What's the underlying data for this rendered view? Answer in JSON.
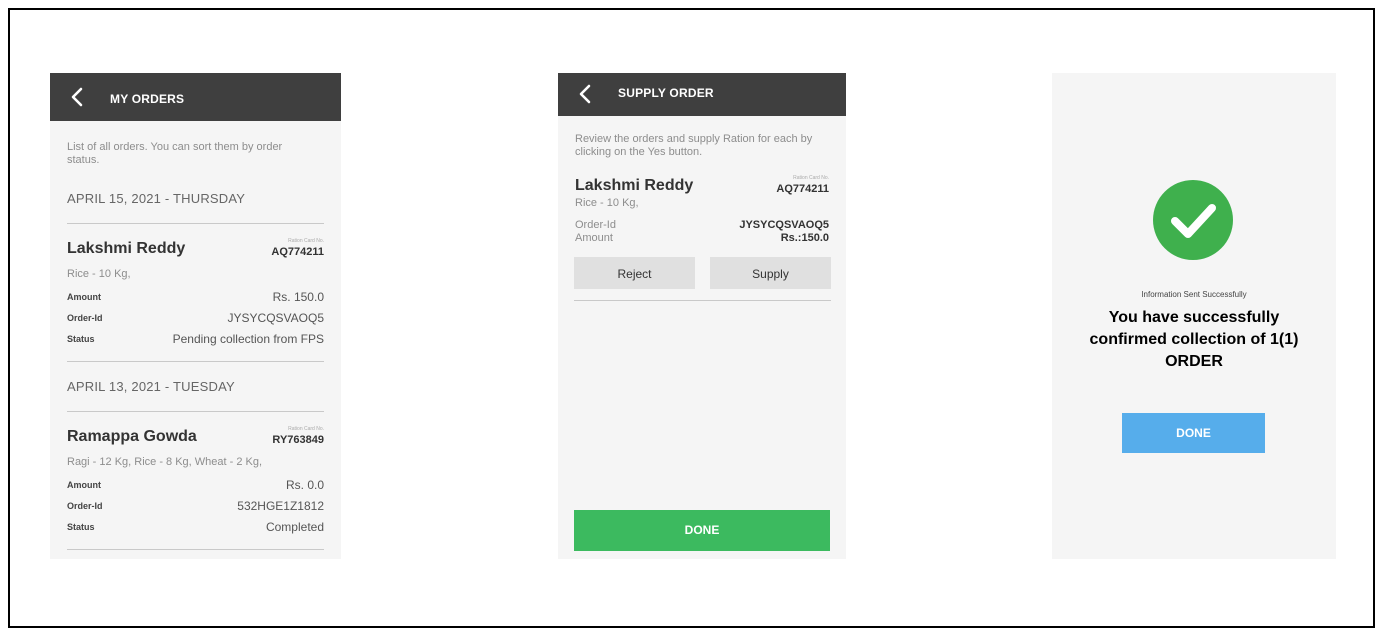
{
  "my_orders": {
    "title": "MY ORDERS",
    "description": "List of all orders. You can sort them by order status.",
    "groups": [
      {
        "date": "APRIL 15, 2021 - THURSDAY",
        "order": {
          "name": "Lakshmi Reddy",
          "ration_card_label": "Ration Card No.",
          "ration_card": "AQ774211",
          "items": "Rice - 10 Kg,",
          "amount_label": "Amount",
          "amount": "Rs. 150.0",
          "order_id_label": "Order-Id",
          "order_id": "JYSYCQSVAOQ5",
          "status_label": "Status",
          "status": "Pending collection from FPS"
        }
      },
      {
        "date": "APRIL 13, 2021 - TUESDAY",
        "order": {
          "name": "Ramappa Gowda",
          "ration_card_label": "Ration Card No.",
          "ration_card": "RY763849",
          "items": "Ragi - 12 Kg, Rice - 8 Kg, Wheat - 2 Kg,",
          "amount_label": "Amount",
          "amount": "Rs. 0.0",
          "order_id_label": "Order-Id",
          "order_id": "532HGE1Z1812",
          "status_label": "Status",
          "status": "Completed"
        }
      }
    ]
  },
  "supply_order": {
    "title": "SUPPLY ORDER",
    "description": "Review the orders and supply Ration for each by clicking on the Yes button.",
    "order": {
      "name": "Lakshmi Reddy",
      "ration_card_label": "Ration Card No.",
      "ration_card": "AQ774211",
      "items": "Rice - 10 Kg,",
      "order_id_label": "Order-Id",
      "order_id": "JYSYCQSVAOQ5",
      "amount_label": "Amount",
      "amount": "Rs.:150.0"
    },
    "reject_label": "Reject",
    "supply_label": "Supply",
    "done_label": "DONE"
  },
  "success": {
    "small_text": "Information Sent Successfully",
    "headline_line1": "You have successfully",
    "headline_line2": "confirmed collection of  1(1)",
    "headline_line3": "ORDER",
    "done_label": "DONE"
  },
  "colors": {
    "appbar": "#3f3f3f",
    "success_green": "#3cba5f",
    "check_green": "#3fb04d",
    "done_blue": "#56adeb"
  }
}
